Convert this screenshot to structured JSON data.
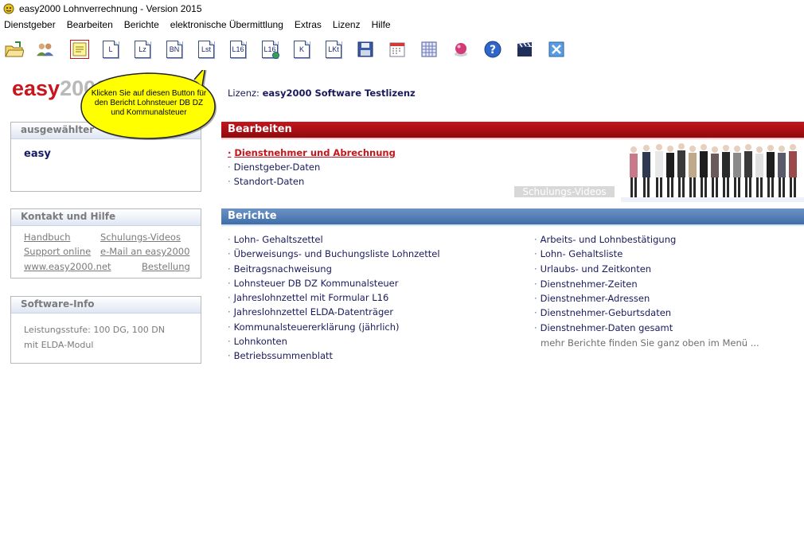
{
  "window": {
    "title": "easy2000 Lohnverrechnung - Version 2015"
  },
  "menu": {
    "items": [
      "Dienstgeber",
      "Bearbeiten",
      "Berichte",
      "elektronische Übermittlung",
      "Extras",
      "Lizenz",
      "Hilfe"
    ]
  },
  "toolbar": {
    "doc_buttons": [
      "L",
      "Lz",
      "BN",
      "Lst",
      "L16",
      "L16",
      "K",
      "LKt"
    ]
  },
  "logo": {
    "part1": "easy",
    "part2": "2000"
  },
  "license": {
    "label": "Lizenz:",
    "value": "easy2000 Software Testlizenz"
  },
  "callout": {
    "text": "Klicken Sie auf diesen Button für den Bericht Lohnsteuer DB DZ und Kommunalsteuer"
  },
  "left_panels": {
    "selected": {
      "title": "ausgewählter",
      "user": "easy"
    },
    "contact": {
      "title": "Kontakt und Hilfe",
      "links": [
        "Handbuch",
        "Schulungs-Videos",
        "Support online",
        "e-Mail an easy2000",
        "www.easy2000.net",
        "Bestellung"
      ]
    },
    "software": {
      "title": "Software-Info",
      "line1": "Leistungsstufe: 100 DG, 100 DN",
      "line2": "mit ELDA-Modul"
    }
  },
  "bearbeiten": {
    "title": "Bearbeiten",
    "items": [
      "Dienstnehmer und Abrechnung",
      "Dienstgeber-Daten",
      "Standort-Daten"
    ],
    "video_label": "Schulungs-Videos"
  },
  "berichte": {
    "title": "Berichte",
    "col1": [
      "Lohn- Gehaltszettel",
      "Überweisungs- und Buchungsliste Lohnzettel",
      "Beitragsnachweisung",
      "Lohnsteuer DB DZ Kommunalsteuer",
      "Jahreslohnzettel mit Formular L16",
      "Jahreslohnzettel ELDA-Datenträger",
      "Kommunalsteuererklärung (jährlich)",
      "Lohnkonten",
      "Betriebssummenblatt"
    ],
    "col2": [
      "Arbeits- und Lohnbestätigung",
      "Lohn- Gehaltsliste",
      "Urlaubs- und Zeitkonten",
      "Dienstnehmer-Zeiten",
      "Dienstnehmer-Adressen",
      "Dienstnehmer-Geburtsdaten",
      "Dienstnehmer-Daten gesamt"
    ],
    "more": "mehr Berichte finden Sie ganz oben im Menü ..."
  },
  "colors": {
    "accent_red": "#c4161c",
    "accent_blue": "#3f6da8",
    "link_navy": "#1a1a5c"
  }
}
